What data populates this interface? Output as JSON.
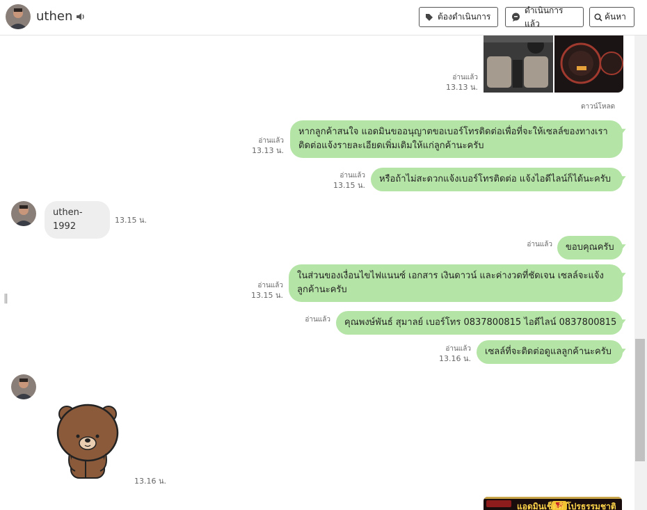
{
  "header": {
    "contact_name": "uthen",
    "btn_pending": "ต้องดำเนินการ",
    "btn_done": "ดำเนินการแล้ว",
    "btn_search": "ค้นหา"
  },
  "messages": {
    "img1": {
      "status": "อ่านแล้ว",
      "time": "13.13 น.",
      "download": "ดาวน์โหลด"
    },
    "m1": {
      "text": "หากลูกค้าสนใจ แอดมินขออนุญาตขอเบอร์โทรติดต่อเพื่อที่จะให้เซลล์ของทางเราติดต่อแจ้งรายละเอียดเพิ่มเติมให้แก่ลูกค้านะครับ",
      "status": "อ่านแล้ว",
      "time": "13.13 น."
    },
    "m2": {
      "text": "หรือถ้าไม่สะดวกแจ้งเบอร์โทรติดต่อ แจ้งไอดีไลน์ก็ได้นะครับ",
      "status": "อ่านแล้ว",
      "time": "13.15 น."
    },
    "in1": {
      "text": "uthen-1992",
      "time": "13.15 น."
    },
    "m3": {
      "text": "ขอบคุณครับ",
      "status": "อ่านแล้ว"
    },
    "m4": {
      "text": "ในส่วนของเงื่อนไขไฟแนนซ์ เอกสาร เงินดาวน์ และค่างวดที่ชัดเจน เซลล์จะแจ้งลูกค้านะครับ",
      "status": "อ่านแล้ว",
      "time": "13.15 น."
    },
    "m5": {
      "text": "คุณพงษ์พันธ์ สุมาลย์ เบอร์โทร 0837800815 ไอดีไลน์ 0837800815",
      "status": "อ่านแล้ว"
    },
    "m6": {
      "text": "เซลล์ที่จะติดต่อดูแลลูกค้านะครับ",
      "status": "อ่านแล้ว",
      "time": "13.16 น."
    },
    "sticker": {
      "time": "13.16 น."
    },
    "banner": {
      "text": "แอดมินเช็คคิ โปรธรรมชาติ"
    }
  },
  "colors": {
    "out_bubble": "#b5e5a6",
    "in_bubble": "#eeeeee"
  }
}
